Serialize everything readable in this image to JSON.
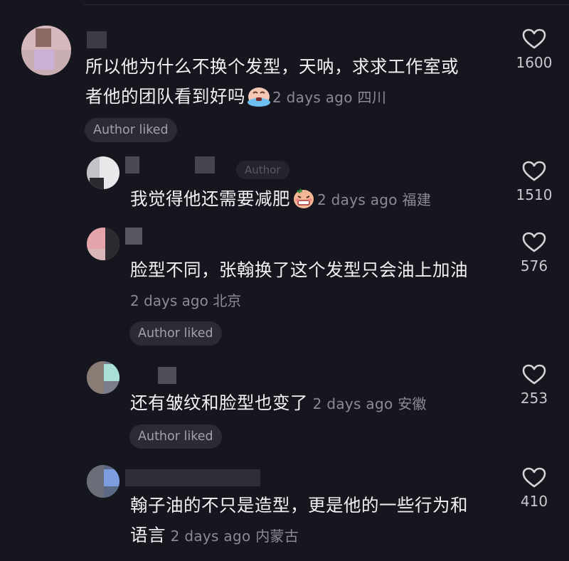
{
  "comments": [
    {
      "text_line1": "所以他为什么不换个发型，天呐，求求工作室或",
      "text_line2": "者他的团队看到好吗",
      "emoji": "crying-face-emoji",
      "time": "2 days ago",
      "location": "四川",
      "author_liked": "Author liked",
      "likes": "1600"
    },
    {
      "author_tag": "Author",
      "text_line1": "我觉得他还需要减肥",
      "emoji": "grimacing-face-emoji",
      "time": "2 days ago",
      "location": "福建",
      "likes": "1510"
    },
    {
      "text_line1": "脸型不同，张翰换了这个发型只会油上加油",
      "time": "2 days ago",
      "location": "北京",
      "author_liked": "Author liked",
      "likes": "576"
    },
    {
      "text_line1": "还有皱纹和脸型也变了",
      "time": "2 days ago",
      "location": "安徽",
      "author_liked": "Author liked",
      "likes": "253"
    },
    {
      "text_line1": "翰子油的不只是造型，更是他的一些行为和",
      "text_line2": "语言",
      "time": "2 days ago",
      "location": "内蒙古",
      "likes": "410"
    }
  ],
  "colors": {
    "background": "#16161e",
    "text": "#f2f2f4",
    "meta": "#8b8b93",
    "badge_bg": "#2b2b33",
    "heart": "#d4d4d8"
  },
  "icons": {
    "like": "heart-outline-icon"
  }
}
